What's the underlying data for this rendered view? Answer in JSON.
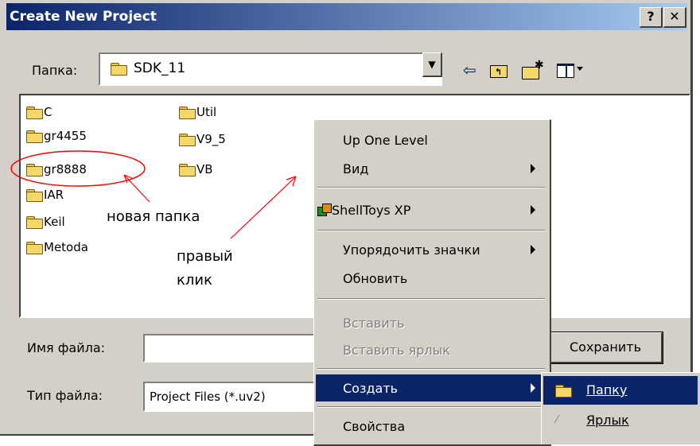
{
  "window": {
    "title": "Create New Project",
    "help_button": "?",
    "close_button": "✕"
  },
  "location": {
    "label": "Папка:",
    "current_folder": "SDK_11"
  },
  "toolbar": {
    "back_icon": "back-arrow-icon",
    "up_icon": "up-one-level-icon",
    "new_folder_icon": "new-folder-icon",
    "view_menu_icon": "view-menu-icon"
  },
  "files": [
    "C",
    "gr4455",
    "gr8888",
    "IAR",
    "Keil",
    "Metoda",
    "Util",
    "V9_5",
    "VB"
  ],
  "annotations": {
    "new_folder": "новая папка",
    "right_click_line1": "правый",
    "right_click_line2": "клик",
    "color": "#ff0000"
  },
  "filename": {
    "label": "Имя файла:",
    "value": ""
  },
  "filetype": {
    "label": "Тип файла:",
    "value": "Project Files (*.uv2)"
  },
  "save_button": "Сохранить",
  "context_menu": {
    "up_one_level": "Up One Level",
    "view": "Вид",
    "shelltoys": "ShellToys XP",
    "arrange_icons": "Упорядочить значки",
    "refresh": "Обновить",
    "paste": "Вставить",
    "paste_shortcut": "Вставить ярлык",
    "create": "Создать",
    "properties": "Свойства"
  },
  "submenu": {
    "folder": "Папку",
    "shortcut": "Ярлык"
  },
  "colors": {
    "face": "#d4d0c8",
    "title_start": "#0a246a",
    "title_end": "#a6caf0",
    "selection": "#0a246a"
  }
}
